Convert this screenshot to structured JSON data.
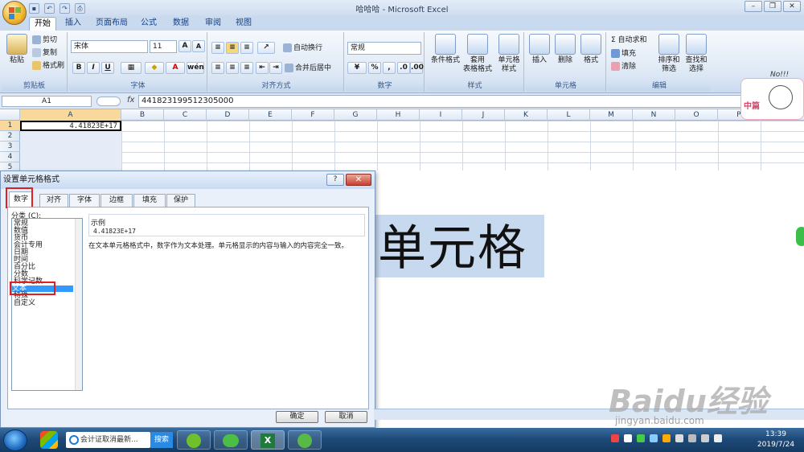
{
  "window": {
    "title": "哈哈哈 - Microsoft Excel"
  },
  "ribbon_tabs": [
    "开始",
    "插入",
    "页面布局",
    "公式",
    "数据",
    "审阅",
    "视图"
  ],
  "ribbon": {
    "clipboard": {
      "paste": "粘贴",
      "cut": "剪切",
      "copy": "复制",
      "format_painter": "格式刷",
      "label": "剪贴板"
    },
    "font": {
      "name": "宋体",
      "size": "11",
      "bold": "B",
      "italic": "I",
      "underline": "U",
      "grow": "A",
      "shrink": "A",
      "label": "字体"
    },
    "alignment": {
      "wrap": "自动换行",
      "merge": "合并后居中",
      "label": "对齐方式"
    },
    "number": {
      "format": "常规",
      "percent": "%",
      "comma": ",",
      "label": "数字"
    },
    "styles": {
      "conditional": "条件格式",
      "table": "套用\n表格格式",
      "cell_styles": "单元格\n样式",
      "label": "样式"
    },
    "cells": {
      "insert": "插入",
      "delete": "删除",
      "format": "格式",
      "label": "单元格"
    },
    "editing": {
      "autosum": "Σ 自动求和",
      "fill": "填充",
      "clear": "清除",
      "sort": "排序和\n筛选",
      "find": "查找和\n选择",
      "label": "编辑"
    }
  },
  "formula_bar": {
    "name_box": "A1",
    "fx": "fx",
    "content": "441823199512305000"
  },
  "columns": [
    "A",
    "B",
    "C",
    "D",
    "E",
    "F",
    "G",
    "H",
    "I",
    "J",
    "K",
    "L",
    "M",
    "N",
    "O",
    "P"
  ],
  "rows": [
    "1",
    "2",
    "3",
    "4",
    "5"
  ],
  "cell_A1": "4.41823E+17",
  "background_text": "单元格",
  "dialog": {
    "title": "设置单元格格式",
    "help": "?",
    "close": "✕",
    "tabs": [
      "数字",
      "对齐",
      "字体",
      "边框",
      "填充",
      "保护"
    ],
    "category_label": "分类 (C):",
    "categories": [
      "常规",
      "数值",
      "货币",
      "会计专用",
      "日期",
      "时间",
      "百分比",
      "分数",
      "科学记数",
      "文本",
      "特殊",
      "自定义"
    ],
    "selected_category": "文本",
    "sample_label": "示例",
    "sample_value": "4.41823E+17",
    "description": "在文本单元格格式中，数字作为文本处理。单元格显示的内容与输入的内容完全一致。",
    "ok": "确定",
    "cancel": "取消"
  },
  "taskbar": {
    "search_text": "会计证取消最新...",
    "search_button": "搜索",
    "time": "13:39",
    "date": "2019/7/24"
  },
  "watermark": {
    "main": "Baidu经验",
    "url": "jingyan.baidu.com"
  },
  "sticker": {
    "text": "中篇",
    "exclaim": "No!!!"
  }
}
